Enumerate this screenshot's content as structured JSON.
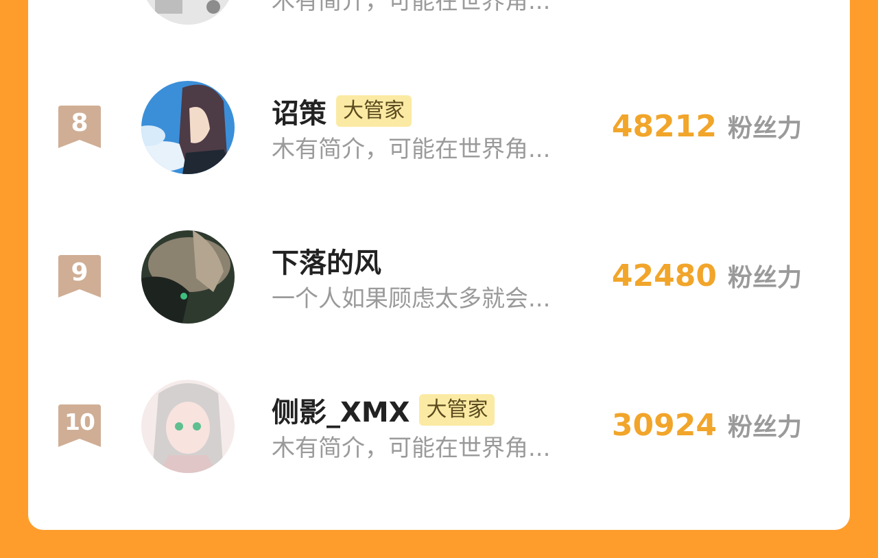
{
  "colors": {
    "page_background": "#ff9d2c",
    "card_background": "#ffffff",
    "fans_number": "#f1a52a",
    "rank_badge": "#cfae95",
    "tag_background": "#fbeaa3"
  },
  "partial_row": {
    "description": "木有简介，可能在世界角..."
  },
  "rows": [
    {
      "rank": "8",
      "name": "诏策",
      "tag": "大管家",
      "description": "木有简介，可能在世界角...",
      "fans": "48212",
      "fans_label": "粉丝力"
    },
    {
      "rank": "9",
      "name": "下落的风",
      "tag": "",
      "description": "一个人如果顾虑太多就会...",
      "fans": "42480",
      "fans_label": "粉丝力"
    },
    {
      "rank": "10",
      "name": "侧影_XMX",
      "tag": "大管家",
      "description": "木有简介，可能在世界角...",
      "fans": "30924",
      "fans_label": "粉丝力"
    }
  ]
}
